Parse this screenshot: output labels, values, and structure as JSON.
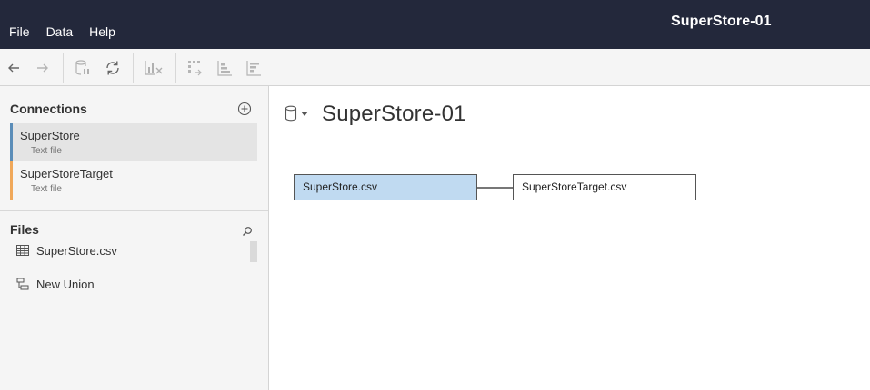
{
  "menu": {
    "items": [
      "File",
      "Data",
      "Help"
    ]
  },
  "window_title": "SuperStore-01",
  "toolbar": {
    "buttons": [
      "back-arrow-icon",
      "forward-arrow-icon",
      "pause-update-icon",
      "refresh-icon",
      "clear-sheet-icon",
      "swap-icon",
      "sort-ascending-icon",
      "sort-descending-icon"
    ]
  },
  "sidebar": {
    "connections_title": "Connections",
    "connections": [
      {
        "name": "SuperStore",
        "type": "Text file",
        "color": "#5b8db8"
      },
      {
        "name": "SuperStoreTarget",
        "type": "Text file",
        "color": "#f0a85a"
      }
    ],
    "files_title": "Files",
    "files": [
      {
        "label": "SuperStore.csv",
        "icon": "table-grid-icon"
      },
      {
        "label": "New Union",
        "icon": "union-icon"
      }
    ]
  },
  "canvas": {
    "datasource_title": "SuperStore-01",
    "tables": [
      {
        "label": "SuperStore.csv",
        "color": "#c0daf1"
      },
      {
        "label": "SuperStoreTarget.csv",
        "color": "#ffffff"
      }
    ]
  }
}
